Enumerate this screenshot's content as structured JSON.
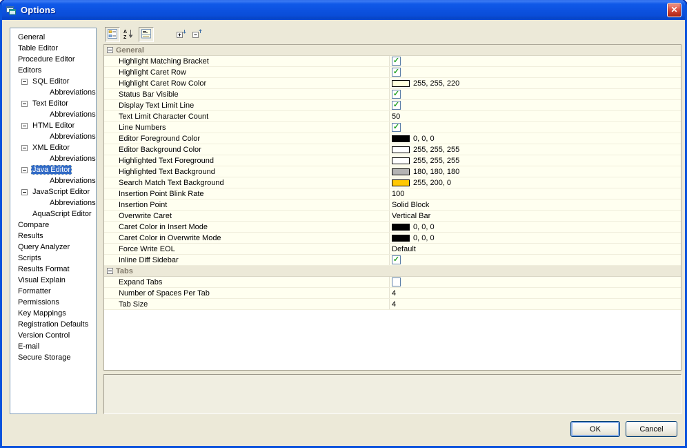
{
  "window": {
    "title": "Options"
  },
  "colors": {
    "titlebar": "#0B50D8",
    "selection": "#316AC5",
    "dialog_bg": "#ECE9D8",
    "row_bg": "#FFFFF0",
    "category_bg": "#ECE9D8"
  },
  "sidebar": {
    "items": [
      {
        "label": "General",
        "indent": 0,
        "expander": false,
        "selected": false
      },
      {
        "label": "Table Editor",
        "indent": 0,
        "expander": false,
        "selected": false
      },
      {
        "label": "Procedure Editor",
        "indent": 0,
        "expander": false,
        "selected": false
      },
      {
        "label": "Editors",
        "indent": 0,
        "expander": false,
        "selected": false
      },
      {
        "label": "SQL Editor",
        "indent": 1,
        "expander": true,
        "selected": false
      },
      {
        "label": "Abbreviations",
        "indent": 2,
        "expander": false,
        "selected": false
      },
      {
        "label": "Text Editor",
        "indent": 1,
        "expander": true,
        "selected": false
      },
      {
        "label": "Abbreviations",
        "indent": 2,
        "expander": false,
        "selected": false
      },
      {
        "label": "HTML Editor",
        "indent": 1,
        "expander": true,
        "selected": false
      },
      {
        "label": "Abbreviations",
        "indent": 2,
        "expander": false,
        "selected": false
      },
      {
        "label": "XML Editor",
        "indent": 1,
        "expander": true,
        "selected": false
      },
      {
        "label": "Abbreviations",
        "indent": 2,
        "expander": false,
        "selected": false
      },
      {
        "label": "Java Editor",
        "indent": 1,
        "expander": true,
        "selected": true
      },
      {
        "label": "Abbreviations",
        "indent": 2,
        "expander": false,
        "selected": false
      },
      {
        "label": "JavaScript Editor",
        "indent": 1,
        "expander": true,
        "selected": false
      },
      {
        "label": "Abbreviations",
        "indent": 2,
        "expander": false,
        "selected": false
      },
      {
        "label": "AquaScript Editor",
        "indent": 1,
        "expander": false,
        "selected": false
      },
      {
        "label": "Compare",
        "indent": 0,
        "expander": false,
        "selected": false
      },
      {
        "label": "Results",
        "indent": 0,
        "expander": false,
        "selected": false
      },
      {
        "label": "Query Analyzer",
        "indent": 0,
        "expander": false,
        "selected": false
      },
      {
        "label": "Scripts",
        "indent": 0,
        "expander": false,
        "selected": false
      },
      {
        "label": "Results Format",
        "indent": 0,
        "expander": false,
        "selected": false
      },
      {
        "label": "Visual Explain",
        "indent": 0,
        "expander": false,
        "selected": false
      },
      {
        "label": "Formatter",
        "indent": 0,
        "expander": false,
        "selected": false
      },
      {
        "label": "Permissions",
        "indent": 0,
        "expander": false,
        "selected": false
      },
      {
        "label": "Key Mappings",
        "indent": 0,
        "expander": false,
        "selected": false
      },
      {
        "label": "Registration Defaults",
        "indent": 0,
        "expander": false,
        "selected": false
      },
      {
        "label": "Version Control",
        "indent": 0,
        "expander": false,
        "selected": false
      },
      {
        "label": "E-mail",
        "indent": 0,
        "expander": false,
        "selected": false
      },
      {
        "label": "Secure Storage",
        "indent": 0,
        "expander": false,
        "selected": false
      }
    ]
  },
  "toolbar": {
    "buttons": [
      {
        "name": "categorized-view",
        "pressed": true
      },
      {
        "name": "alphabetical-sort",
        "pressed": false
      },
      {
        "name": "show-description",
        "pressed": true
      },
      {
        "name": "expand-all",
        "pressed": false
      },
      {
        "name": "collapse-all",
        "pressed": false
      }
    ]
  },
  "property_grid": {
    "sections": [
      {
        "title": "General",
        "rows": [
          {
            "label": "Highlight Matching Bracket",
            "type": "checkbox",
            "checked": true
          },
          {
            "label": "Highlight Caret Row",
            "type": "checkbox",
            "checked": true
          },
          {
            "label": "Highlight Caret Row Color",
            "type": "color",
            "value": "255, 255, 220",
            "swatch": "#FFFFDC"
          },
          {
            "label": "Status Bar Visible",
            "type": "checkbox",
            "checked": true
          },
          {
            "label": "Display Text Limit Line",
            "type": "checkbox",
            "checked": true
          },
          {
            "label": "Text Limit Character Count",
            "type": "text",
            "value": "50"
          },
          {
            "label": "Line Numbers",
            "type": "checkbox",
            "checked": true
          },
          {
            "label": "Editor Foreground Color",
            "type": "color",
            "value": "0, 0, 0",
            "swatch": "#000000"
          },
          {
            "label": "Editor Background Color",
            "type": "color",
            "value": "255, 255, 255",
            "swatch": "#FFFFFF"
          },
          {
            "label": "Highlighted Text Foreground",
            "type": "color",
            "value": "255, 255, 255",
            "swatch": "#FFFFFF"
          },
          {
            "label": "Highlighted Text Background",
            "type": "color",
            "value": "180, 180, 180",
            "swatch": "#B4B4B4"
          },
          {
            "label": "Search Match Text Background",
            "type": "color",
            "value": "255, 200, 0",
            "swatch": "#FFC800"
          },
          {
            "label": "Insertion Point Blink Rate",
            "type": "text",
            "value": "100"
          },
          {
            "label": "Insertion Point",
            "type": "text",
            "value": "Solid Block"
          },
          {
            "label": "Overwrite Caret",
            "type": "text",
            "value": "Vertical Bar"
          },
          {
            "label": "Caret Color in Insert Mode",
            "type": "color",
            "value": "0, 0, 0",
            "swatch": "#000000"
          },
          {
            "label": "Caret Color in Overwrite Mode",
            "type": "color",
            "value": "0, 0, 0",
            "swatch": "#000000"
          },
          {
            "label": "Force Write EOL",
            "type": "text",
            "value": "Default"
          },
          {
            "label": "Inline Diff Sidebar",
            "type": "checkbox",
            "checked": true
          }
        ]
      },
      {
        "title": "Tabs",
        "rows": [
          {
            "label": "Expand Tabs",
            "type": "checkbox",
            "checked": false
          },
          {
            "label": "Number of Spaces Per Tab",
            "type": "text",
            "value": "4"
          },
          {
            "label": "Tab Size",
            "type": "text",
            "value": "4"
          }
        ]
      }
    ]
  },
  "footer": {
    "ok_label": "OK",
    "cancel_label": "Cancel"
  },
  "misc": {
    "close_glyph": "✕",
    "check_glyph": "✓"
  }
}
